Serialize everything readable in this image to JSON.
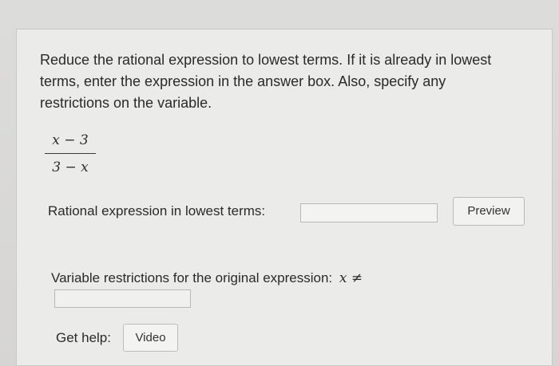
{
  "question": {
    "text": "Reduce the rational expression to lowest terms. If it is already in lowest terms, enter the expression in the answer box. Also, specify any restrictions on the variable."
  },
  "expression": {
    "numerator": "x − 3",
    "denominator": "3 − x"
  },
  "answer": {
    "label": "Rational expression in lowest terms:",
    "value": "",
    "preview_label": "Preview"
  },
  "restrictions": {
    "label": "Variable restrictions for the original expression:",
    "math": "x ≠",
    "value": ""
  },
  "help": {
    "label": "Get help:",
    "video_label": "Video"
  }
}
